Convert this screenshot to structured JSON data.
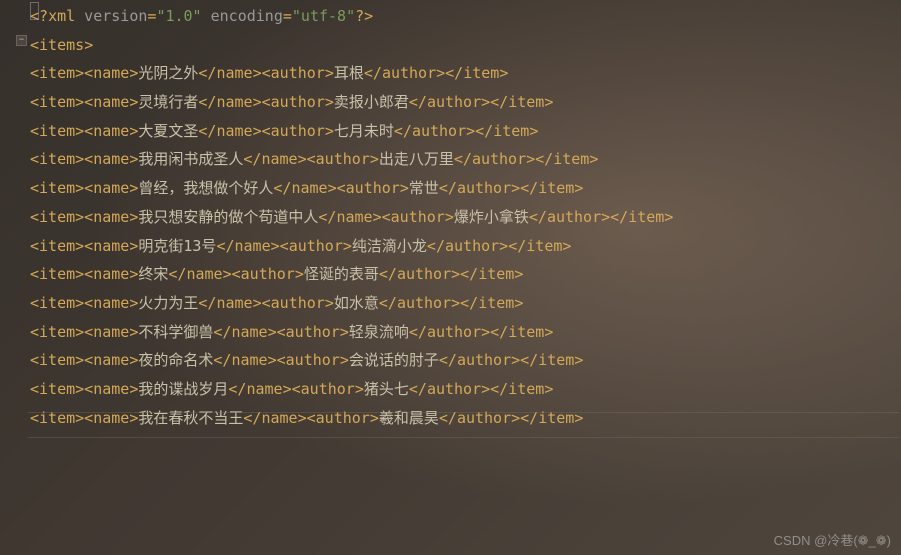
{
  "xml_decl": {
    "open": "<?",
    "name": "xml",
    "attrs": [
      {
        "k": "version",
        "v": "\"1.0\""
      },
      {
        "k": "encoding",
        "v": "\"utf-8\""
      }
    ],
    "close": "?>"
  },
  "root_tag": "items",
  "items": [
    {
      "name": "光阴之外",
      "author": "耳根"
    },
    {
      "name": "灵境行者",
      "author": "卖报小郎君"
    },
    {
      "name": "大夏文圣",
      "author": "七月未时"
    },
    {
      "name": "我用闲书成圣人",
      "author": "出走八万里"
    },
    {
      "name": "曾经，我想做个好人",
      "author": "常世"
    },
    {
      "name": "我只想安静的做个苟道中人",
      "author": "爆炸小拿铁"
    },
    {
      "name": "明克街13号",
      "author": "纯洁滴小龙"
    },
    {
      "name": "终宋",
      "author": "怪诞的表哥"
    },
    {
      "name": "火力为王",
      "author": "如水意"
    },
    {
      "name": "不科学御兽",
      "author": "轻泉流响"
    },
    {
      "name": "夜的命名术",
      "author": "会说话的肘子"
    },
    {
      "name": "我的谍战岁月",
      "author": "猪头七"
    },
    {
      "name": "我在春秋不当王",
      "author": "羲和晨昊"
    }
  ],
  "fold_symbol": "−",
  "watermark": "CSDN @冷巷(❁_❁)"
}
